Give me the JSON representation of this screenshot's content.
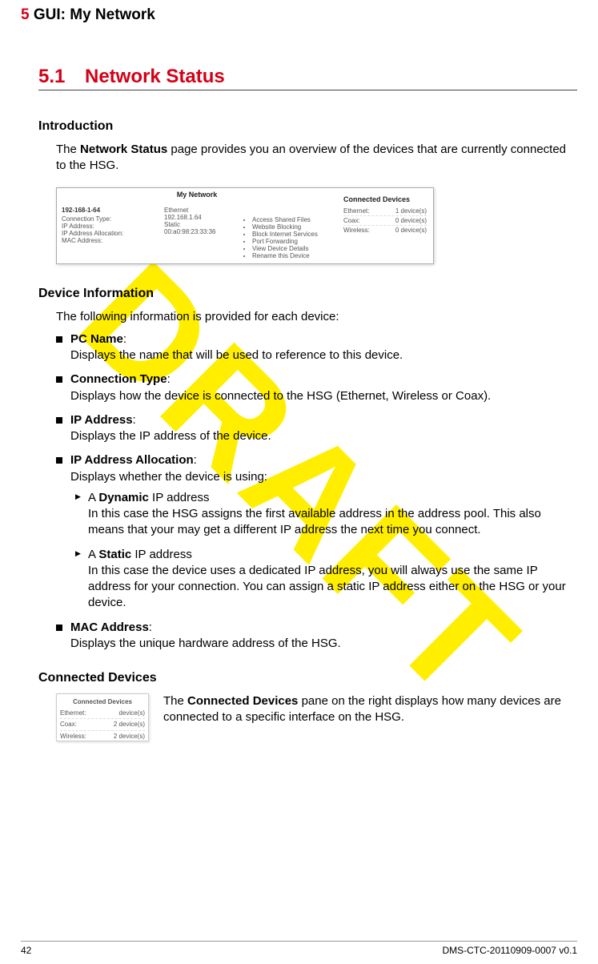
{
  "watermark": "DRAFT",
  "header": {
    "chapter_num": "5",
    "chapter_title": "GUI: My Network"
  },
  "section": {
    "num": "5.1",
    "title": "Network Status"
  },
  "intro": {
    "heading": "Introduction",
    "text_before": "The ",
    "bold": "Network Status",
    "text_after": " page provides you an overview of the devices that are currently connected to the HSG."
  },
  "screenshot": {
    "my_network_title": "My Network",
    "connected_title": "Connected Devices",
    "device_name": "192-168-1-64",
    "fields": {
      "conn_type_label": "Connection Type:",
      "ip_label": "IP Address:",
      "ip_alloc_label": "IP Address Allocation:",
      "mac_label": "MAC Address:"
    },
    "col2": {
      "eth_icon": "Ethernet",
      "ip_value": "192.168.1.64",
      "alloc_value": "Static",
      "mac_value": "00:a0:98:23:33:36"
    },
    "actions": [
      "Access Shared Files",
      "Website Blocking",
      "Block Internet Services",
      "Port Forwarding",
      "View Device Details",
      "Rename this Device"
    ],
    "cd_rows": [
      {
        "if": "Ethernet:",
        "val": "1 device(s)"
      },
      {
        "if": "Coax:",
        "val": "0 device(s)"
      },
      {
        "if": "Wireless:",
        "val": "0 device(s)"
      }
    ]
  },
  "device_info": {
    "heading": "Device Information",
    "lead": "The following information is provided for each device:",
    "items": [
      {
        "title": "PC Name",
        "desc": "Displays the name that will be used to reference to this device."
      },
      {
        "title": "Connection Type",
        "desc": "Displays how the device is connected to the HSG (Ethernet, Wireless or Coax)."
      },
      {
        "title": "IP Address",
        "desc": "Displays the IP address of the device."
      },
      {
        "title": "IP Address Allocation",
        "desc": "Displays whether the device is using:",
        "sub": [
          {
            "lead": "A ",
            "bold": "Dynamic",
            "tail": " IP address",
            "detail": "In this case the HSG assigns the first available address in the address pool. This also means that your may get a different IP address the next time you connect."
          },
          {
            "lead": "A ",
            "bold": "Static",
            "tail": " IP address",
            "detail": "In this case the device uses a dedicated IP address, you will always use the same IP address for your connection. You can assign a static IP address either on the HSG or your device."
          }
        ]
      },
      {
        "title": "MAC Address",
        "desc": "Displays the unique hardware address of the HSG."
      }
    ]
  },
  "connected": {
    "heading": "Connected Devices",
    "text_before": "The ",
    "bold": "Connected Devices",
    "text_after": " pane on the right displays how many devices are connected to a specific interface on the HSG.",
    "thumb": {
      "title": "Connected Devices",
      "rows": [
        {
          "if": "Ethernet:",
          "val": "device(s)"
        },
        {
          "if": "Coax:",
          "val": "2 device(s)"
        },
        {
          "if": "Wireless:",
          "val": "2 device(s)"
        }
      ]
    }
  },
  "footer": {
    "page": "42",
    "doc": "DMS-CTC-20110909-0007 v0.1"
  }
}
